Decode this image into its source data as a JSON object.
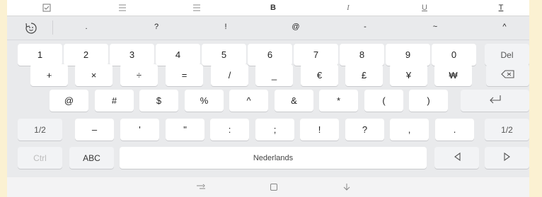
{
  "toolbar": {
    "items": [
      {
        "name": "screenshot-icon"
      },
      {
        "name": "bullet-list-icon"
      },
      {
        "name": "numbered-list-icon"
      },
      {
        "label": "B"
      },
      {
        "label": "I"
      },
      {
        "label": "U"
      },
      {
        "label": "T"
      }
    ]
  },
  "symbols": [
    ".",
    "?",
    "!",
    "@",
    "-",
    "~",
    "^"
  ],
  "keys": {
    "row1": [
      "1",
      "2",
      "3",
      "4",
      "5",
      "6",
      "7",
      "8",
      "9",
      "0",
      "Del"
    ],
    "row2": [
      "+",
      "×",
      "÷",
      "=",
      "/",
      "_",
      "€",
      "£",
      "¥",
      "₩"
    ],
    "row3": [
      "@",
      "#",
      "$",
      "%",
      "^",
      "&",
      "*",
      "(",
      ")"
    ],
    "row4": [
      "1/2",
      "–",
      "'",
      "\"",
      ":",
      ";",
      "!",
      "?",
      ",",
      ".",
      "1/2"
    ],
    "row5": {
      "ctrl": "Ctrl",
      "abc": "ABC",
      "space": "Nederlands"
    }
  },
  "icons": {
    "emoji": "emoji-refresh-icon",
    "backspace": "backspace-icon",
    "enter": "enter-icon",
    "left": "arrow-left-icon",
    "right": "arrow-right-icon",
    "recent": "recent-apps-icon",
    "home": "home-icon",
    "back": "hide-keyboard-icon"
  }
}
